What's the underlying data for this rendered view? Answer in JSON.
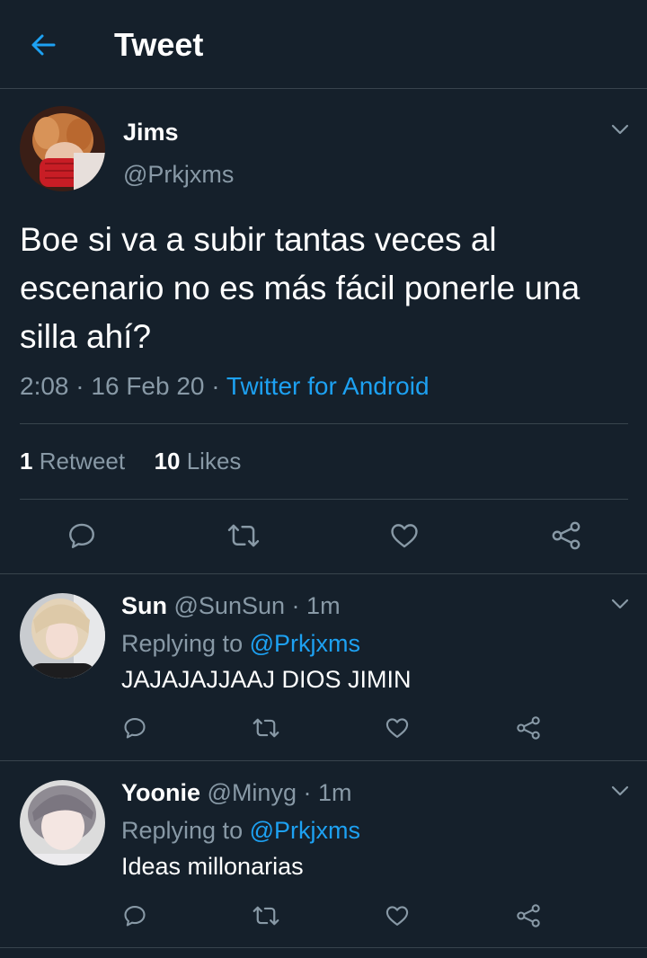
{
  "header": {
    "title": "Tweet"
  },
  "tweet": {
    "name": "Jims",
    "handle": "@Prkjxms",
    "text": "Boe si va a subir tantas veces al escenario no es más fácil ponerle una silla ahí?",
    "time": "2:08",
    "date": "16 Feb 20",
    "source": "Twitter for Android",
    "retweets_count": "1",
    "retweets_label": "Retweet",
    "likes_count": "10",
    "likes_label": "Likes"
  },
  "replies": [
    {
      "name": "Sun",
      "handle": "@SunSun",
      "time": "1m",
      "replying_label": "Replying to",
      "mention": "@Prkjxms",
      "text": "JAJAJAJJAAJ DIOS JIMIN"
    },
    {
      "name": "Yoonie",
      "handle": "@Minyg",
      "time": "1m",
      "replying_label": "Replying to",
      "mention": "@Prkjxms",
      "text": "Ideas millonarias"
    }
  ],
  "colors": {
    "background": "#15202b",
    "accent": "#1da1f2",
    "secondary_text": "#8899a6",
    "divider": "#38444d"
  },
  "icons": [
    "back-arrow-icon",
    "chevron-down-icon",
    "reply-icon",
    "retweet-icon",
    "like-icon",
    "share-icon"
  ]
}
